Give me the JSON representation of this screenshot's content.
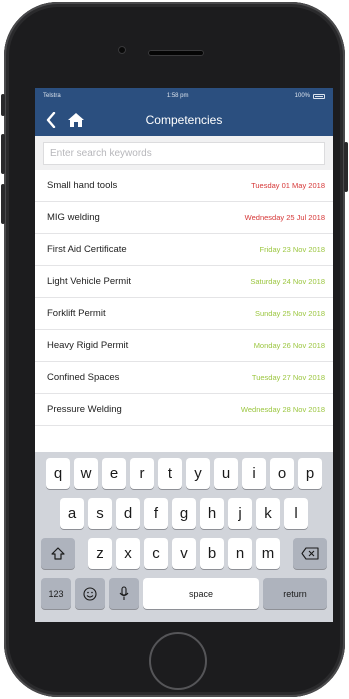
{
  "status_bar": {
    "carrier": "Telstra",
    "time": "1:58 pm",
    "battery": "100%"
  },
  "nav": {
    "title": "Competencies",
    "back_icon": "chevron-left-icon",
    "home_icon": "home-icon"
  },
  "search": {
    "placeholder": "Enter search keywords",
    "value": ""
  },
  "competencies": [
    {
      "name": "Small hand tools",
      "date": "Tuesday 01 May 2018",
      "status": "expired"
    },
    {
      "name": "MIG welding",
      "date": "Wednesday 25 Jul 2018",
      "status": "expired"
    },
    {
      "name": "First Aid Certificate",
      "date": "Friday 23 Nov 2018",
      "status": "valid"
    },
    {
      "name": "Light Vehicle Permit",
      "date": "Saturday 24 Nov 2018",
      "status": "valid"
    },
    {
      "name": "Forklift Permit",
      "date": "Sunday 25 Nov 2018",
      "status": "valid"
    },
    {
      "name": "Heavy Rigid Permit",
      "date": "Monday 26 Nov 2018",
      "status": "valid"
    },
    {
      "name": "Confined Spaces",
      "date": "Tuesday 27 Nov 2018",
      "status": "valid"
    },
    {
      "name": "Pressure Welding",
      "date": "Wednesday 28 Nov 2018",
      "status": "valid"
    }
  ],
  "colors": {
    "nav_bar": "#2b4f7f",
    "expired": "#d63838",
    "valid": "#9bc63f"
  },
  "keyboard": {
    "row1": [
      "q",
      "w",
      "e",
      "r",
      "t",
      "y",
      "u",
      "i",
      "o",
      "p"
    ],
    "row2": [
      "a",
      "s",
      "d",
      "f",
      "g",
      "h",
      "j",
      "k",
      "l"
    ],
    "row3": [
      "z",
      "x",
      "c",
      "v",
      "b",
      "n",
      "m"
    ],
    "numbers_label": "123",
    "space_label": "space",
    "return_label": "return"
  }
}
